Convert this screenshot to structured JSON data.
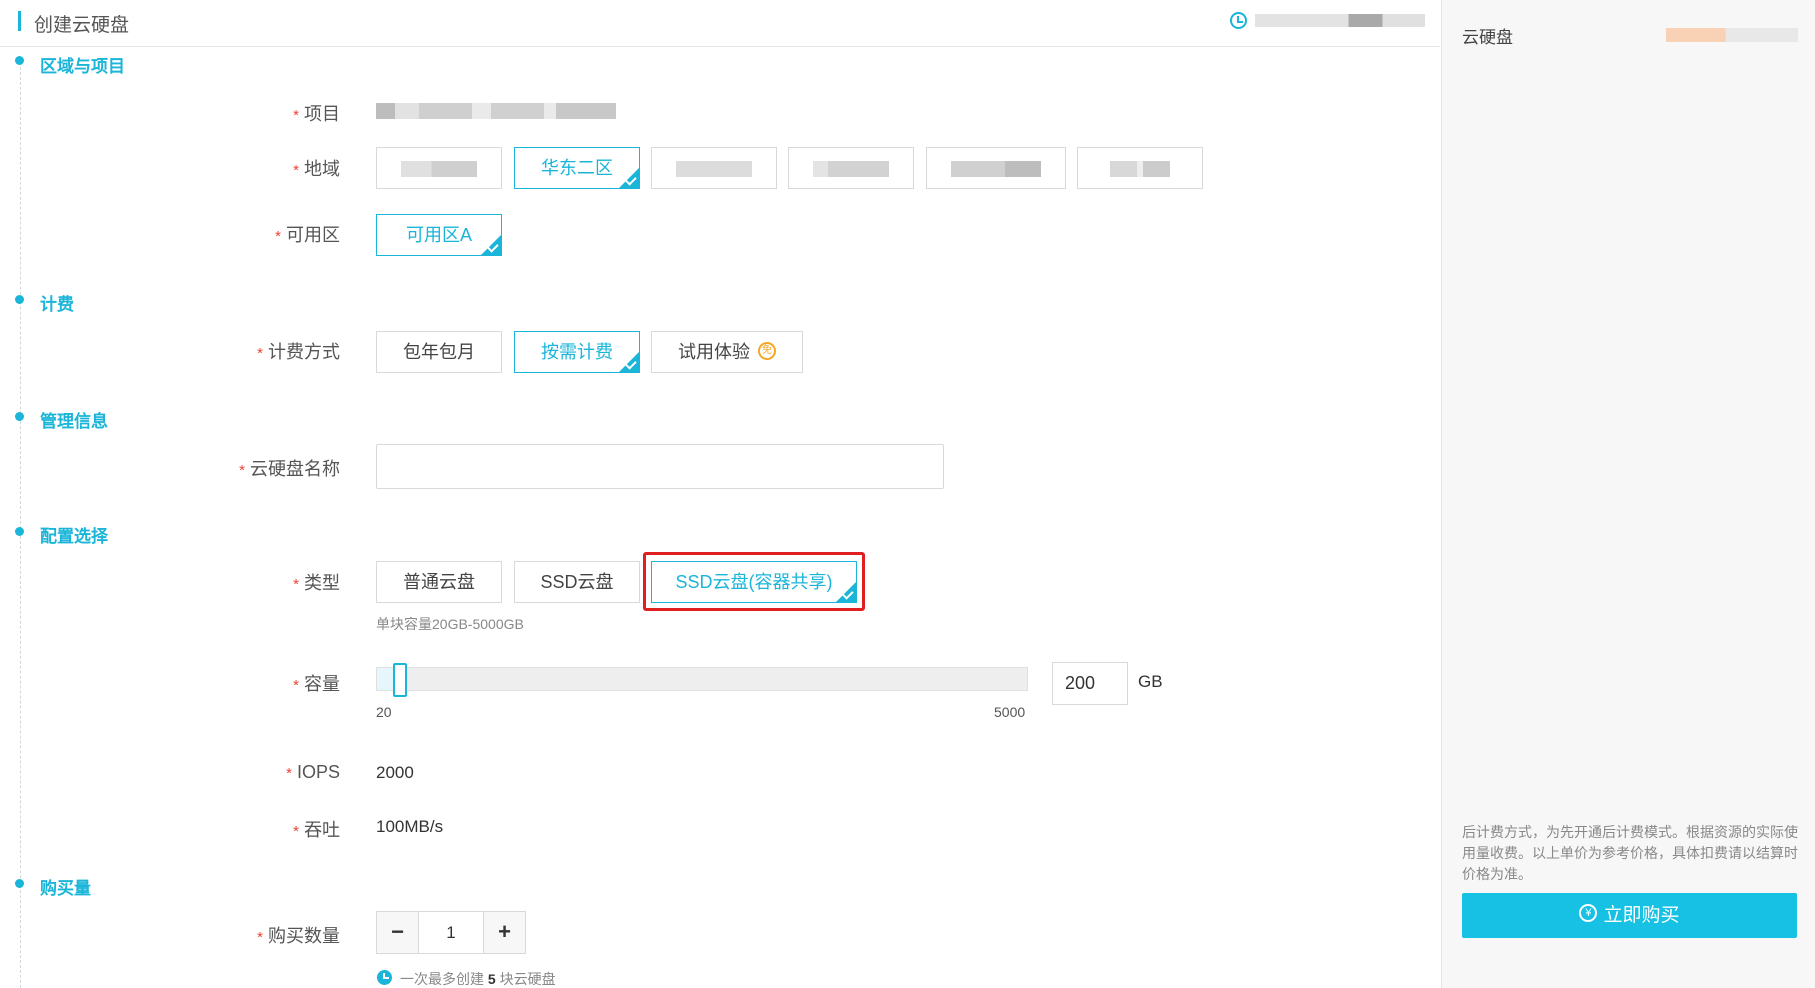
{
  "header": {
    "title": "创建云硬盘"
  },
  "sections": {
    "region": "区域与项目",
    "billing": "计费",
    "manage": "管理信息",
    "config": "配置选择",
    "purchase": "购买量"
  },
  "form": {
    "project_label": "项目",
    "region_label": "地域",
    "region_selected": "华东二区",
    "zone_label": "可用区",
    "zone_selected": "可用区A",
    "billing_label": "计费方式",
    "billing_options": [
      "包年包月",
      "按需计费",
      "试用体验"
    ],
    "billing_selected": "按需计费",
    "trial_badge": "免",
    "name_label": "云硬盘名称",
    "name_value": "",
    "type_label": "类型",
    "type_options": [
      "普通云盘",
      "SSD云盘",
      "SSD云盘(容器共享)"
    ],
    "type_selected": "SSD云盘(容器共享)",
    "type_hint": "单块容量20GB-5000GB",
    "capacity_label": "容量",
    "capacity_min": "20",
    "capacity_max": "5000",
    "capacity_value": "200",
    "capacity_unit": "GB",
    "iops_label": "IOPS",
    "iops_value": "2000",
    "throughput_label": "吞吐",
    "throughput_value": "100MB/s",
    "quantity_label": "购买数量",
    "quantity_value": "1",
    "quantity_minus": "−",
    "quantity_plus": "+",
    "quantity_note_prefix": "一次最多创建",
    "quantity_note_max": "5",
    "quantity_note_suffix": "块云硬盘"
  },
  "sidebar": {
    "title": "云硬盘",
    "description": "后计费方式，为先开通后计费模式。根据资源的实际使用量收费。以上单价为参考价格，具体扣费请以结算时价格为准。",
    "buy_label": "立即购买",
    "buy_icon": "¥"
  },
  "colors": {
    "accent": "#1ab5d8",
    "required": "#f04134",
    "highlight": "#e02020",
    "buy_button": "#17c1e3"
  }
}
